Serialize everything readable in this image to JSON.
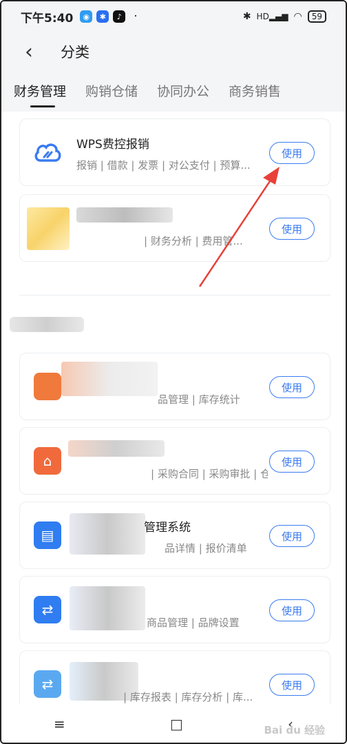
{
  "status_bar": {
    "time": "下午5:40",
    "dot": "·",
    "battery": "59",
    "network_label": "HD",
    "bluetooth_icon": "bluetooth-icon",
    "signal_icon": "signal-icon",
    "wifi_icon": "wifi-icon"
  },
  "header": {
    "back_icon": "‹",
    "title": "分类"
  },
  "tabs": [
    {
      "label": "财务管理",
      "active": true
    },
    {
      "label": "购销仓储",
      "active": false
    },
    {
      "label": "协同办公",
      "active": false
    },
    {
      "label": "商务销售",
      "active": false
    }
  ],
  "cards": [
    {
      "name": "WPS费控报销",
      "desc": "报销 | 借款 | 发票 | 对公支付 | 预算...",
      "button": "使用",
      "icon": "cloud-icon",
      "color": "#3a7bf0"
    },
    {
      "name": "",
      "desc": "| 财务分析 | 费用管...",
      "button": "使用",
      "icon": "yellow-app-icon",
      "color": "#f5c542"
    },
    {
      "name": "",
      "desc": "品管理 | 库存统计",
      "button": "使用",
      "icon": "orange-app-icon",
      "color": "#f07a3c"
    },
    {
      "name": "",
      "desc": "| 采购合同 | 采购审批 | 仓...",
      "button": "使用",
      "icon": "orange-house-icon",
      "color": "#f06a3c"
    },
    {
      "name": "管理系统",
      "desc": "品详情 | 报价清单",
      "button": "使用",
      "icon": "blue-doc-icon",
      "color": "#2f7df0"
    },
    {
      "name": "",
      "desc": "商品管理 | 品牌设置",
      "button": "使用",
      "icon": "blue-clipboard-icon",
      "color": "#2f7df0"
    },
    {
      "name": "",
      "desc": "| 库存报表 | 库存分析 | 库...",
      "button": "使用",
      "icon": "light-blue-clipboard-icon",
      "color": "#5aa9f0"
    }
  ],
  "nav": {
    "menu_icon": "≡",
    "home_icon": "□",
    "back_icon": "‹"
  },
  "watermark": "Bai du 经验"
}
